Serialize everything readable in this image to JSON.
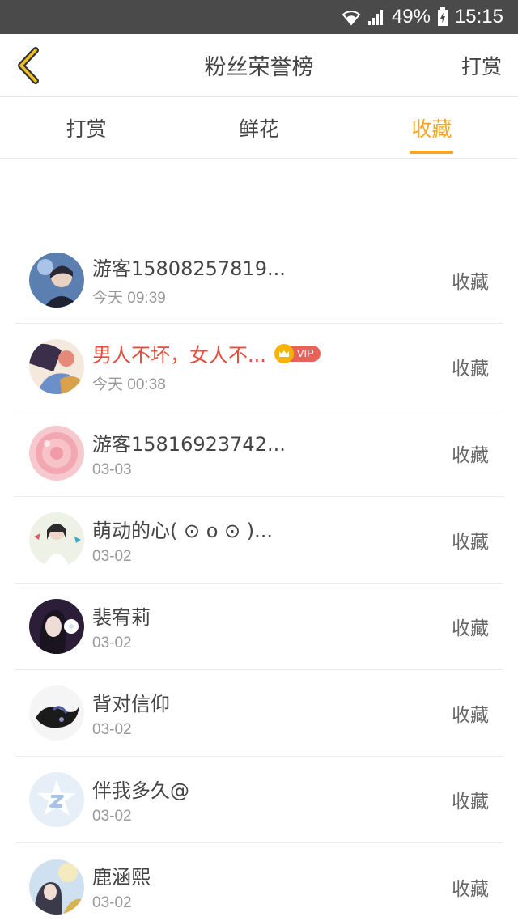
{
  "status_bar": {
    "battery": "49%",
    "time": "15:15"
  },
  "nav": {
    "title": "粉丝荣誉榜",
    "right_label": "打赏"
  },
  "tabs": [
    {
      "label": "打赏",
      "active": false
    },
    {
      "label": "鲜花",
      "active": false
    },
    {
      "label": "收藏",
      "active": true
    }
  ],
  "colors": {
    "accent": "#f5a623",
    "vip_name": "#e74c3c",
    "vip_badge": "#e8625a"
  },
  "fans": [
    {
      "name": "游客15808257819...",
      "time": "今天 09:39",
      "action": "收藏",
      "vip": false
    },
    {
      "name": "男人不坏，女人不...",
      "time": "今天 00:38",
      "action": "收藏",
      "vip": true,
      "vip_label": "VIP"
    },
    {
      "name": "游客15816923742...",
      "time": "03-03",
      "action": "收藏",
      "vip": false
    },
    {
      "name": "萌动的心( ⊙ o ⊙ )...",
      "time": "03-02",
      "action": "收藏",
      "vip": false
    },
    {
      "name": "裴宥莉",
      "time": "03-02",
      "action": "收藏",
      "vip": false
    },
    {
      "name": "背对信仰",
      "time": "03-02",
      "action": "收藏",
      "vip": false
    },
    {
      "name": "伴我多久@",
      "time": "03-02",
      "action": "收藏",
      "vip": false
    },
    {
      "name": "鹿涵熙",
      "time": "03-02",
      "action": "收藏",
      "vip": false
    }
  ]
}
